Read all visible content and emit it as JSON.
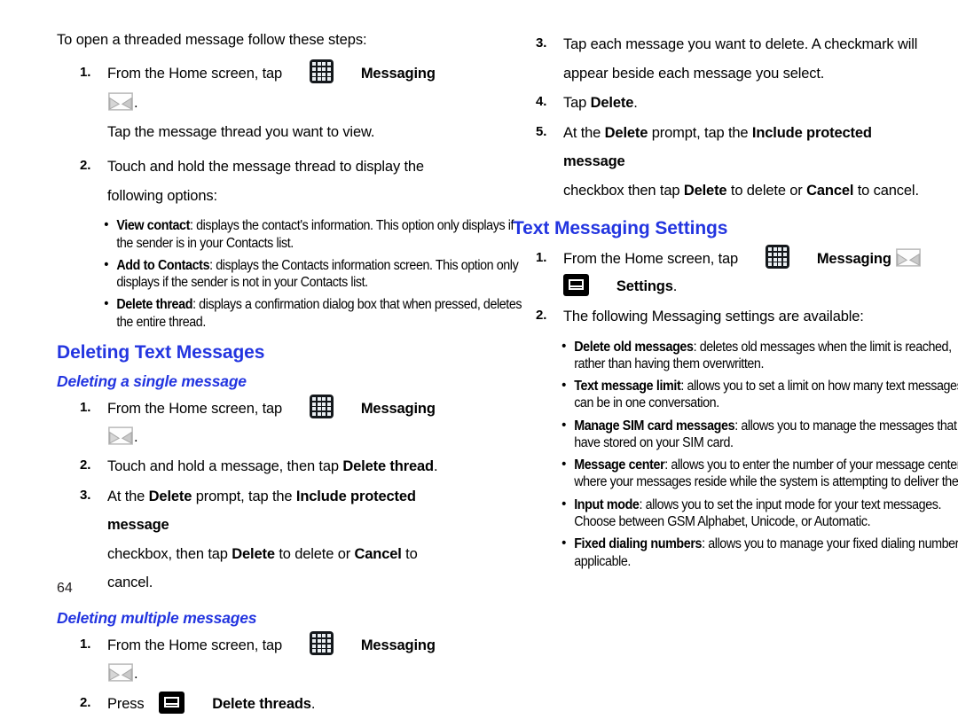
{
  "page": {
    "number": "64",
    "heading_color": "#2335E0"
  },
  "icons": {
    "apps_grid": "apps-grid-icon",
    "menu": "menu-icon",
    "envelope": "messaging-envelope-icon"
  },
  "left_column": {
    "intro": "To open a threaded message follow these steps:",
    "steps": [
      {
        "num": "1.",
        "pre": "From the Home screen, tap",
        "label": "Messaging",
        "post": ".",
        "sub": "Tap the message thread you want to view."
      },
      {
        "num": "2.",
        "line1": "Touch and hold the message thread to display the",
        "line2": "following options:"
      }
    ],
    "bullets": [
      {
        "term": "View contact",
        "text": ": displays the contact's information. This option only displays if the sender is in your Contacts list."
      },
      {
        "term": "Add to Contacts",
        "text": ": displays the Contacts information screen. This option only displays if the sender is not in your Contacts list."
      },
      {
        "term": "Delete thread",
        "text": ": displays a confirmation dialog box that when pressed, deletes the entire thread."
      }
    ],
    "heading": "Deleting Text Messages",
    "subhead_single": "Deleting a single message",
    "single_steps": [
      {
        "num": "1.",
        "pre": "From the Home screen, tap",
        "label": "Messaging",
        "post": "."
      },
      {
        "num": "2.",
        "pre": "Touch and hold a message, then tap",
        "bold": "Delete thread",
        "post": "."
      },
      {
        "num": "3.",
        "line1_a": "At the",
        "line1_b": "Delete",
        "line1_c": "prompt, tap the",
        "line1_d": "Include protected message",
        "line2_a": "checkbox, then tap",
        "line2_b": "Delete",
        "line2_c": "to delete or",
        "line2_d": "Cancel",
        "line2_e": "to cancel."
      }
    ],
    "subhead_multiple": "Deleting multiple messages",
    "multiple_steps": [
      {
        "num": "1.",
        "pre": "From the Home screen, tap",
        "label": "Messaging",
        "post": "."
      },
      {
        "num": "2.",
        "pre": "Press",
        "bold": "Delete threads",
        "post": "."
      }
    ]
  },
  "right_column": {
    "steps": [
      {
        "num": "3.",
        "line1": "Tap each message you want to delete. A checkmark will",
        "line2": "appear beside each message you select."
      },
      {
        "num": "4.",
        "pre": "Tap",
        "bold": "Delete",
        "post": "."
      },
      {
        "num": "5.",
        "line1_a": "At the",
        "line1_b": "Delete",
        "line1_c": "prompt, tap the",
        "line1_d": "Include protected message",
        "line2_a": "checkbox then tap",
        "line2_b": "Delete",
        "line2_c": "to delete or",
        "line2_d": "Cancel",
        "line2_e": "to cancel."
      }
    ],
    "heading": "Text Messaging Settings",
    "settings_steps": [
      {
        "num": "1.",
        "pre": "From the Home screen, tap",
        "label": "Messaging",
        "settings_label": "Settings",
        "post": "."
      },
      {
        "num": "2.",
        "text": "The following Messaging settings are available:"
      }
    ],
    "bullets": [
      {
        "term": "Delete old messages",
        "text": ": deletes old messages when the limit is reached, rather than having them overwritten."
      },
      {
        "term": "Text message limit",
        "text": ": allows you to set a limit on how many text messages can be in one conversation."
      },
      {
        "term": "Manage SIM card messages",
        "text": ": allows you to manage the messages that you have stored on your SIM card."
      },
      {
        "term": "Message center",
        "text": ": allows you to enter the number of your message center where your messages reside while the system is attempting to deliver them."
      },
      {
        "term": "Input mode",
        "text": ": allows you to set the input mode for your text messages. Choose between GSM Alphabet, Unicode, or Automatic."
      },
      {
        "term": "Fixed dialing numbers",
        "text": ": allows you to manage your fixed dialing numbers if applicable."
      }
    ]
  }
}
